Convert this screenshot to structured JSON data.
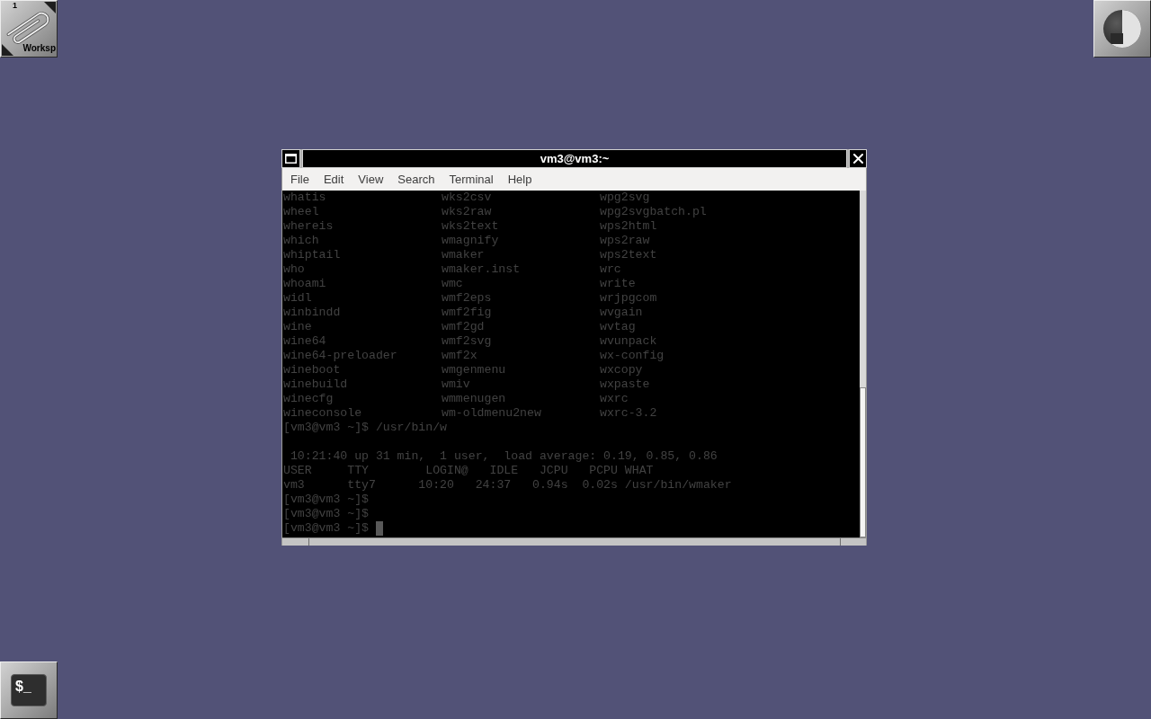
{
  "workspace_clip": {
    "number": "1",
    "label": "Worksp"
  },
  "terminal_window": {
    "title": "vm3@vm3:~",
    "menu": [
      "File",
      "Edit",
      "View",
      "Search",
      "Terminal",
      "Help"
    ],
    "listing": [
      [
        "whatis",
        "wks2csv",
        "wpg2svg"
      ],
      [
        "wheel",
        "wks2raw",
        "wpg2svgbatch.pl"
      ],
      [
        "whereis",
        "wks2text",
        "wps2html"
      ],
      [
        "which",
        "wmagnify",
        "wps2raw"
      ],
      [
        "whiptail",
        "wmaker",
        "wps2text"
      ],
      [
        "who",
        "wmaker.inst",
        "wrc"
      ],
      [
        "whoami",
        "wmc",
        "write"
      ],
      [
        "widl",
        "wmf2eps",
        "wrjpgcom"
      ],
      [
        "winbindd",
        "wmf2fig",
        "wvgain"
      ],
      [
        "wine",
        "wmf2gd",
        "wvtag"
      ],
      [
        "wine64",
        "wmf2svg",
        "wvunpack"
      ],
      [
        "wine64-preloader",
        "wmf2x",
        "wx-config"
      ],
      [
        "wineboot",
        "wmgenmenu",
        "wxcopy"
      ],
      [
        "winebuild",
        "wmiv",
        "wxpaste"
      ],
      [
        "winecfg",
        "wmmenugen",
        "wxrc"
      ],
      [
        "wineconsole",
        "wm-oldmenu2new",
        "wxrc-3.2"
      ]
    ],
    "lines": [
      {
        "kind": "line",
        "text": "[vm3@vm3 ~]$ /usr/bin/w",
        "cursor": false
      },
      {
        "kind": "blank"
      },
      {
        "kind": "line",
        "text": " 10:21:40 up 31 min,  1 user,  load average: 0.19, 0.85, 0.86",
        "cursor": false
      },
      {
        "kind": "line",
        "text": "USER     TTY        LOGIN@   IDLE   JCPU   PCPU WHAT",
        "cursor": false
      },
      {
        "kind": "line",
        "text": "vm3      tty7      10:20   24:37   0.94s  0.02s /usr/bin/wmaker",
        "cursor": false
      },
      {
        "kind": "line",
        "text": "[vm3@vm3 ~]$",
        "cursor": false
      },
      {
        "kind": "line",
        "text": "[vm3@vm3 ~]$",
        "cursor": false
      },
      {
        "kind": "line",
        "text": "[vm3@vm3 ~]$",
        "cursor": true
      }
    ]
  },
  "dock_app": {
    "icon_text": "$_"
  }
}
